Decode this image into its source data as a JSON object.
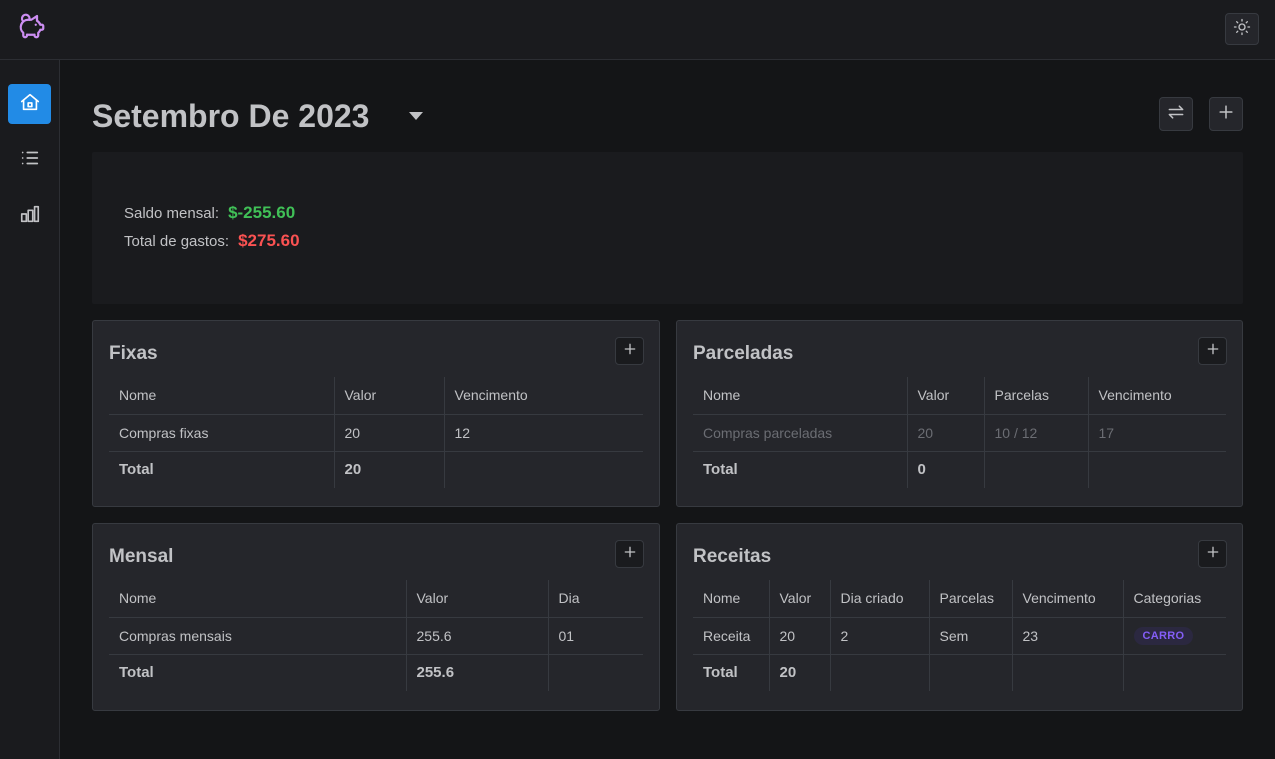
{
  "header": {
    "logo_icon": "piggy-bank-icon",
    "theme_toggle_icon": "sun-icon"
  },
  "sidebar": {
    "items": [
      {
        "icon": "home-icon",
        "active": true
      },
      {
        "icon": "list-icon",
        "active": false
      },
      {
        "icon": "chart-bar-icon",
        "active": false
      }
    ]
  },
  "page": {
    "title": "Setembro De 2023",
    "actions": [
      {
        "icon": "switch-arrows-icon"
      },
      {
        "icon": "plus-icon"
      }
    ]
  },
  "summary": {
    "saldo_label": "Saldo mensal:",
    "saldo_value": "$-255.60",
    "gastos_label": "Total de gastos:",
    "gastos_value": "$275.60"
  },
  "fixas": {
    "title": "Fixas",
    "headers": [
      "Nome",
      "Valor",
      "Vencimento"
    ],
    "rows": [
      [
        "Compras fixas",
        "20",
        "12"
      ]
    ],
    "total": [
      "Total",
      "20",
      ""
    ]
  },
  "parceladas": {
    "title": "Parceladas",
    "headers": [
      "Nome",
      "Valor",
      "Parcelas",
      "Vencimento"
    ],
    "rows": [
      [
        "Compras parceladas",
        "20",
        "10 / 12",
        "17"
      ]
    ],
    "total": [
      "Total",
      "0",
      "",
      ""
    ]
  },
  "mensal": {
    "title": "Mensal",
    "headers": [
      "Nome",
      "Valor",
      "Dia"
    ],
    "rows": [
      [
        "Compras mensais",
        "255.6",
        "01"
      ]
    ],
    "total": [
      "Total",
      "255.6",
      ""
    ]
  },
  "receitas": {
    "title": "Receitas",
    "headers": [
      "Nome",
      "Valor",
      "Dia criado",
      "Parcelas",
      "Vencimento",
      "Categorias"
    ],
    "rows": [
      [
        "Receita",
        "20",
        "2",
        "Sem",
        "23",
        "CARRO"
      ]
    ],
    "total": [
      "Total",
      "20",
      "",
      "",
      "",
      ""
    ]
  },
  "colors": {
    "accent": "#228be6",
    "positive": "#40c057",
    "negative": "#fa5252",
    "badge": "#845ef7",
    "logo": "#cc8ef2"
  }
}
